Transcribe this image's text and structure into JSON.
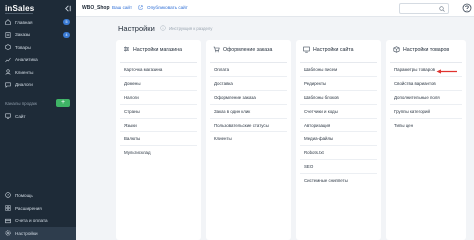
{
  "sidebar": {
    "logo": "inSales",
    "items": [
      {
        "label": "Главная",
        "icon": "home-icon",
        "badge": "5"
      },
      {
        "label": "Заказы",
        "icon": "orders-icon",
        "badge": "4"
      },
      {
        "label": "Товары",
        "icon": "products-icon",
        "badge": ""
      },
      {
        "label": "Аналитика",
        "icon": "analytics-icon",
        "badge": ""
      },
      {
        "label": "Клиенты",
        "icon": "clients-icon",
        "badge": ""
      },
      {
        "label": "Диалоги",
        "icon": "dialogs-icon",
        "badge": ""
      }
    ],
    "channels_label": "Каналы продаж",
    "channels_add": "+",
    "site_label": "Сайт",
    "bottom_items": [
      {
        "label": "Помощь",
        "icon": "help-circle-icon"
      },
      {
        "label": "Расширения",
        "icon": "extensions-icon"
      },
      {
        "label": "Счета и оплата",
        "icon": "billing-icon"
      },
      {
        "label": "Настройки",
        "icon": "settings-icon"
      }
    ]
  },
  "topbar": {
    "shop_name": "WBO_Shop",
    "visit_link": "Ваш сайт",
    "publish_link": "Опубликовать сайт",
    "search_placeholder": ""
  },
  "main": {
    "title": "Настройки",
    "guide_link": "Инструкция к разделу"
  },
  "cards": [
    {
      "title": "Настройки магазина",
      "icon": "store-settings-icon",
      "items": [
        "Карточка магазина",
        "Домены",
        "Налоги",
        "Страны",
        "Языки",
        "Валюты",
        "Мультисклад"
      ]
    },
    {
      "title": "Оформление заказа",
      "icon": "checkout-icon",
      "items": [
        "Оплата",
        "Доставка",
        "Оформление заказа",
        "Заказ в один клик",
        "Пользовательские статусы",
        "Клиенты"
      ]
    },
    {
      "title": "Настройки сайта",
      "icon": "site-settings-icon",
      "items": [
        "Шаблоны писем",
        "Редиректы",
        "Шаблоны блоков",
        "Счетчики и коды",
        "Авторизация",
        "Медиа-файлы",
        "Robots.txt",
        "SEO",
        "Системные сниппеты"
      ]
    },
    {
      "title": "Настройки товаров",
      "icon": "product-settings-icon",
      "items": [
        "Параметры товаров",
        "Свойства вариантов",
        "Дополнительные поля",
        "Группы категорий",
        "Типы цен"
      ]
    }
  ],
  "colors": {
    "sidebar_bg": "#1e2b38",
    "accent_blue": "#2f6fd6",
    "add_green": "#3fb466",
    "arrow_red": "#e0332f"
  }
}
